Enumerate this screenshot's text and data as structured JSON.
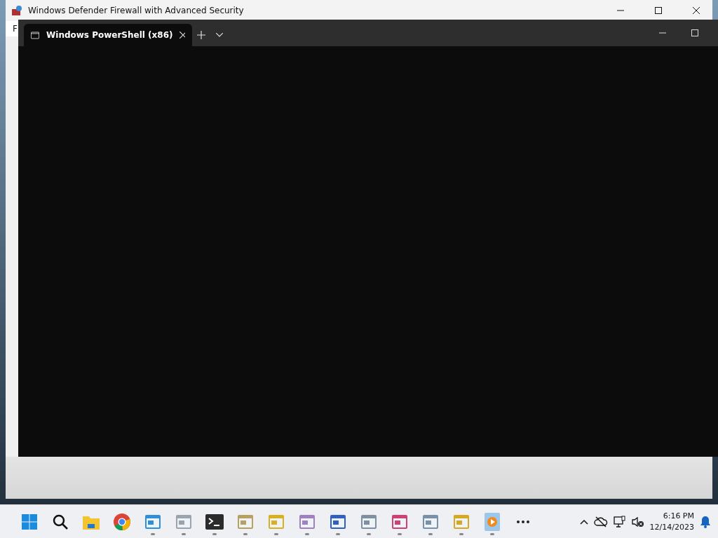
{
  "background_window": {
    "title": "Windows Defender Firewall with Advanced Security",
    "menu_partial": "F"
  },
  "terminal_window": {
    "tabs": [
      {
        "label": "Windows PowerShell (x86)",
        "selected": true
      }
    ]
  },
  "taskbar": {
    "items": [
      {
        "kind": "start",
        "running": false
      },
      {
        "kind": "search",
        "running": false
      },
      {
        "kind": "folder",
        "running": false
      },
      {
        "kind": "browser",
        "running": false
      },
      {
        "kind": "app",
        "color": "#2f8fd8",
        "running": true
      },
      {
        "kind": "app",
        "color": "#9aa3b0",
        "running": true
      },
      {
        "kind": "terminal",
        "running": true
      },
      {
        "kind": "app",
        "color": "#b8a060",
        "running": true
      },
      {
        "kind": "app",
        "color": "#d8b020",
        "running": true
      },
      {
        "kind": "app",
        "color": "#a080c0",
        "running": true
      },
      {
        "kind": "app",
        "color": "#3060c0",
        "running": true
      },
      {
        "kind": "app",
        "color": "#8090a0",
        "running": true
      },
      {
        "kind": "app",
        "color": "#d04070",
        "running": true
      },
      {
        "kind": "app",
        "color": "#7890a8",
        "running": true
      },
      {
        "kind": "app",
        "color": "#d8a820",
        "running": true
      },
      {
        "kind": "media",
        "running": true
      },
      {
        "kind": "more",
        "running": false
      }
    ],
    "clock": {
      "time": "6:16 PM",
      "date": "12/14/2023"
    }
  }
}
